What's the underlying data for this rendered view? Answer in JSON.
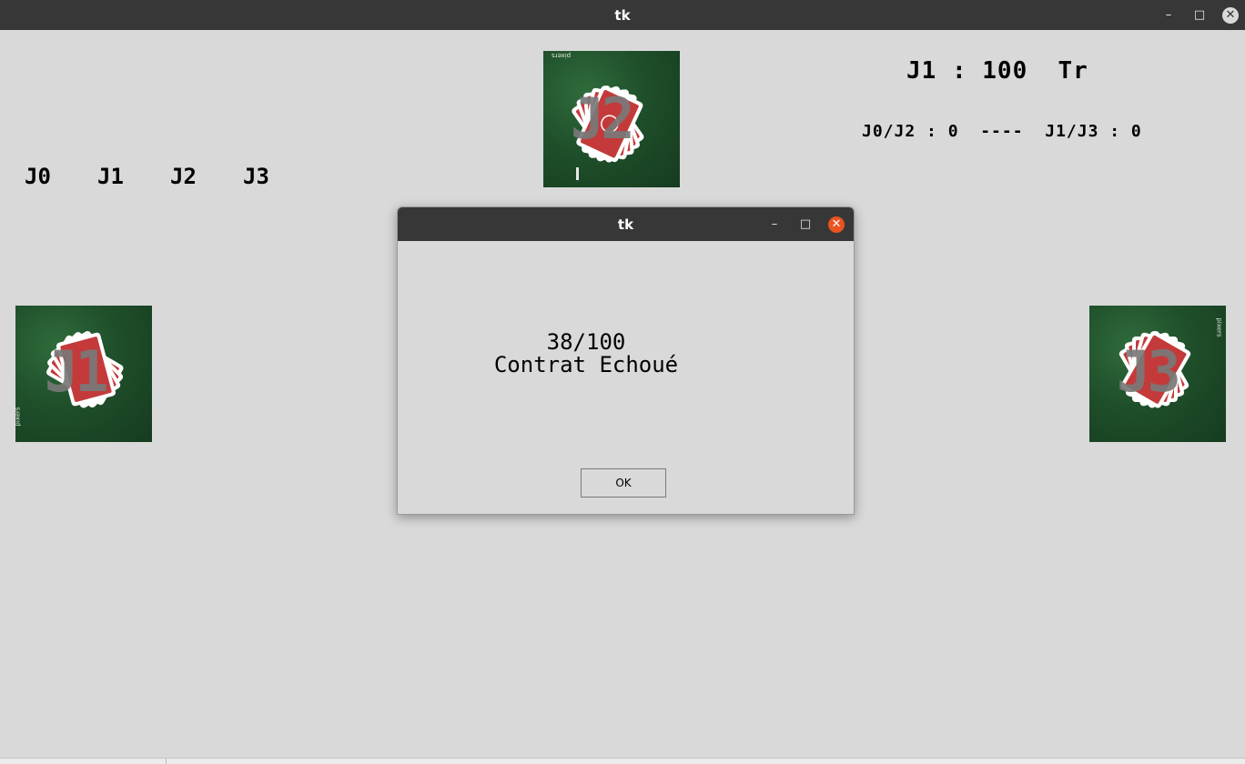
{
  "window": {
    "title": "tk",
    "controls": {
      "minimize": "–",
      "maximize": "□",
      "close": "✕"
    }
  },
  "scoreboard": {
    "contract": "J1 : 100  Tr",
    "teams": "J0/J2 : 0  ----  J1/J3 : 0"
  },
  "players": [
    "J0",
    "J1",
    "J2",
    "J3"
  ],
  "hands": {
    "top": {
      "label": "J2",
      "watermark": "pixers"
    },
    "left": {
      "label": "J1",
      "watermark": "pixers"
    },
    "right": {
      "label": "J3",
      "watermark": "pixers"
    }
  },
  "dialog": {
    "title": "tk",
    "score": "38/100",
    "result": "Contrat Echoué",
    "ok_label": "OK"
  },
  "colors": {
    "titlebar": "#373737",
    "background": "#d9d9d9",
    "table_green": "#1f4f2a",
    "card_red": "#c43a3a",
    "close_orange": "#e95420"
  }
}
